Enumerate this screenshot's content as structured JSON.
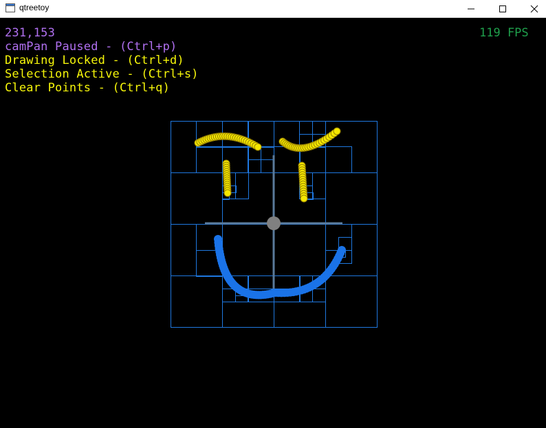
{
  "window": {
    "title": "qtreetoy",
    "icon": "app-window-icon",
    "controls": [
      "minimize-icon",
      "maximize-icon",
      "close-icon"
    ]
  },
  "hud": {
    "coords": "231,153",
    "campan": "camPan Paused - (Ctrl+p)",
    "drawing": "Drawing Locked - (Ctrl+d)",
    "selection": "Selection Active - (Ctrl+s)",
    "clear": "Clear Points - (Ctrl+q)",
    "fps": "119 FPS"
  },
  "colors": {
    "background": "#000000",
    "grid": "#1f78e0",
    "points": "#1a73e8",
    "selected": "#f5e800",
    "selected_outline": "#9a8400",
    "hud_purple": "#b070f0",
    "hud_yellow": "#f5f50a",
    "fps_green": "#1fa04c",
    "crosshair": "#5a7a9a",
    "center": "#808080"
  }
}
